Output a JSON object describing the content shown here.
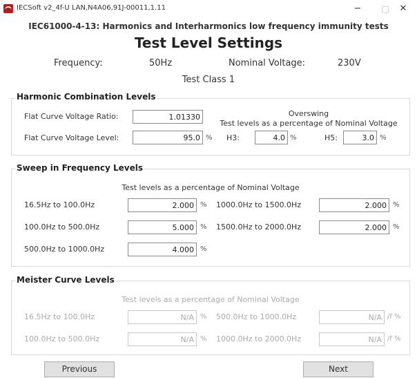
{
  "window": {
    "title": "IECSoft v2_4f-U    LAN,N4A06,91J-00011,1.11",
    "minimize": "−",
    "maximize": "□",
    "close": "✕"
  },
  "header": {
    "subtitle": "IEC61000-4-13: Harmonics and Interharmonics low frequency immunity tests",
    "title": "Test Level Settings",
    "frequency_label": "Frequency:",
    "frequency_value": "50Hz",
    "voltage_label": "Nominal Voltage:",
    "voltage_value": "230V",
    "test_class": "Test Class 1"
  },
  "harmonic": {
    "title": "Harmonic Combination Levels",
    "ratio_label": "Flat Curve Voltage Ratio:",
    "ratio_value": "1.01330",
    "level_label": "Flat Curve Voltage Level:",
    "level_value": "95.0",
    "level_unit": "%",
    "overswing_title": "Overswing",
    "overswing_desc": "Test levels as a percentage of Nominal Voltage",
    "h3_label": "H3:",
    "h3_value": "4.0",
    "h3_unit": "%",
    "h5_label": "H5:",
    "h5_value": "3.0",
    "h5_unit": "%"
  },
  "sweep": {
    "title": "Sweep in Frequency Levels",
    "desc": "Test levels as a percentage of Nominal Voltage",
    "rows": [
      {
        "label": "16.5Hz to 100.0Hz",
        "value": "2.000",
        "unit": "%"
      },
      {
        "label": "100.0Hz to 500.0Hz",
        "value": "5.000",
        "unit": "%"
      },
      {
        "label": "500.0Hz to 1000.0Hz",
        "value": "4.000",
        "unit": "%"
      },
      {
        "label": "1000.0Hz to 1500.0Hz",
        "value": "2.000",
        "unit": "%"
      },
      {
        "label": "1500.0Hz to 2000.0Hz",
        "value": "2.000",
        "unit": "%"
      }
    ]
  },
  "meister": {
    "title": "Meister Curve Levels",
    "desc": "Test levels as a percentage of Nominal Voltage",
    "rows": [
      {
        "label": "16.5Hz to 100.0Hz",
        "value": "N/A",
        "unit": "%"
      },
      {
        "label": "100.0Hz to 500.0Hz",
        "value": "N/A",
        "unit": "%"
      },
      {
        "label": "500.0Hz to 1000.0Hz",
        "value": "N/A",
        "unit": "/f %"
      },
      {
        "label": "1000.0Hz to 2000.0Hz",
        "value": "N/A",
        "unit": "/f %"
      }
    ]
  },
  "buttons": {
    "previous": "Previous",
    "next": "Next"
  }
}
